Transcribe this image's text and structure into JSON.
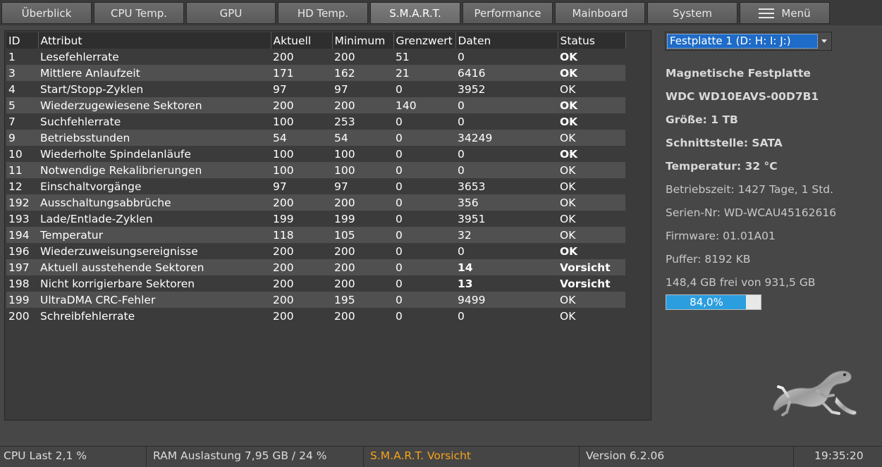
{
  "tabs": [
    {
      "label": "Überblick"
    },
    {
      "label": "CPU Temp."
    },
    {
      "label": "GPU"
    },
    {
      "label": "HD Temp."
    },
    {
      "label": "S.M.A.R.T."
    },
    {
      "label": "Performance"
    },
    {
      "label": "Mainboard"
    },
    {
      "label": "System"
    },
    {
      "label": "Menü"
    }
  ],
  "table": {
    "headers": [
      "ID",
      "Attribut",
      "Aktuell",
      "Minimum",
      "Grenzwert",
      "Daten",
      "Status"
    ],
    "rows": [
      {
        "id": "1",
        "attr": "Lesefehlerrate",
        "akt": "200",
        "min": "200",
        "gr": "51",
        "dat": "0",
        "status": "OK"
      },
      {
        "id": "3",
        "attr": "Mittlere Anlaufzeit",
        "akt": "171",
        "min": "162",
        "gr": "21",
        "dat": "6416",
        "status": "OK"
      },
      {
        "id": "4",
        "attr": "Start/Stopp-Zyklen",
        "akt": "97",
        "min": "97",
        "gr": "0",
        "dat": "3952",
        "status": "OK"
      },
      {
        "id": "5",
        "attr": "Wiederzugewiesene Sektoren",
        "akt": "200",
        "min": "200",
        "gr": "140",
        "dat": "0",
        "status": "OK"
      },
      {
        "id": "7",
        "attr": "Suchfehlerrate",
        "akt": "100",
        "min": "253",
        "gr": "0",
        "dat": "0",
        "status": "OK"
      },
      {
        "id": "9",
        "attr": "Betriebsstunden",
        "akt": "54",
        "min": "54",
        "gr": "0",
        "dat": "34249",
        "status": "OK"
      },
      {
        "id": "10",
        "attr": "Wiederholte Spindelanläufe",
        "akt": "100",
        "min": "100",
        "gr": "0",
        "dat": "0",
        "status": "OK"
      },
      {
        "id": "11",
        "attr": "Notwendige Rekalibrierungen",
        "akt": "100",
        "min": "100",
        "gr": "0",
        "dat": "0",
        "status": "OK"
      },
      {
        "id": "12",
        "attr": "Einschaltvorgänge",
        "akt": "97",
        "min": "97",
        "gr": "0",
        "dat": "3653",
        "status": "OK"
      },
      {
        "id": "192",
        "attr": "Ausschaltungsabbrüche",
        "akt": "200",
        "min": "200",
        "gr": "0",
        "dat": "356",
        "status": "OK"
      },
      {
        "id": "193",
        "attr": "Lade/Entlade-Zyklen",
        "akt": "199",
        "min": "199",
        "gr": "0",
        "dat": "3951",
        "status": "OK"
      },
      {
        "id": "194",
        "attr": "Temperatur",
        "akt": "118",
        "min": "105",
        "gr": "0",
        "dat": "32",
        "status": "OK"
      },
      {
        "id": "196",
        "attr": "Wiederzuweisungsereignisse",
        "akt": "200",
        "min": "200",
        "gr": "0",
        "dat": "0",
        "status": "OK"
      },
      {
        "id": "197",
        "attr": "Aktuell ausstehende Sektoren",
        "akt": "200",
        "min": "200",
        "gr": "0",
        "dat": "14",
        "status": "Vorsicht"
      },
      {
        "id": "198",
        "attr": "Nicht korrigierbare Sektoren",
        "akt": "200",
        "min": "200",
        "gr": "0",
        "dat": "13",
        "status": "Vorsicht"
      },
      {
        "id": "199",
        "attr": "UltraDMA CRC-Fehler",
        "akt": "200",
        "min": "195",
        "gr": "0",
        "dat": "9499",
        "status": "OK"
      },
      {
        "id": "200",
        "attr": "Schreibfehlerrate",
        "akt": "200",
        "min": "200",
        "gr": "0",
        "dat": "0",
        "status": "OK"
      }
    ]
  },
  "info": {
    "drive_select": "Festplatte 1 (D: H: I: J:)",
    "type": "Magnetische Festplatte",
    "model": "WDC WD10EAVS-00D7B1",
    "size": "Größe: 1 TB",
    "interface": "Schnittstelle: SATA",
    "temperature": "Temperatur: 32 °C",
    "uptime": "Betriebszeit: 1427 Tage, 1 Std.",
    "serial": "Serien-Nr: WD-WCAU45162616",
    "firmware": "Firmware: 01.01A01",
    "buffer": "Puffer: 8192 KB",
    "free": "148,4 GB frei von 931,5 GB",
    "usage_label": "84,0%",
    "usage_percent": 84.0
  },
  "statusbar": {
    "cpu": "CPU Last 2,1 %",
    "ram": "RAM Auslastung 7,95 GB / 24 %",
    "smart": "S.M.A.R.T. Vorsicht",
    "version": "Version 6.2.06",
    "time": "19:35:20"
  },
  "colors": {
    "ok_green": "#1a8c1a",
    "warning": "#f7a21a",
    "selection_blue": "#1e6bc8",
    "usage_bar": "#2b9ee0"
  },
  "icons": {
    "menu": "hamburger-icon",
    "logo": "gecko-logo-icon"
  }
}
